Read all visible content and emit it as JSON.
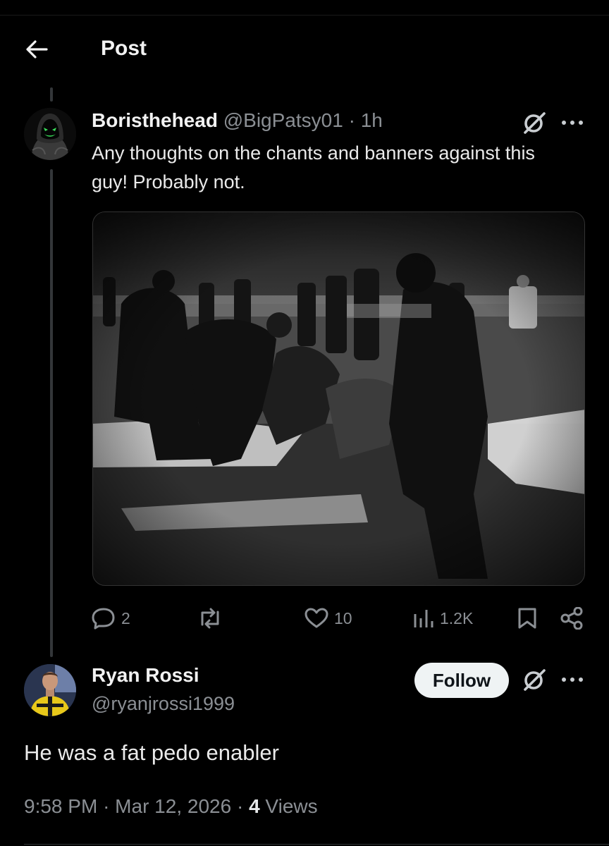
{
  "header": {
    "title": "Post"
  },
  "post": {
    "display_name": "Boristhehead",
    "handle": "@BigPatsy01",
    "separator": "·",
    "time": "1h",
    "text": "Any thoughts on the chants and banners against this guy! Probably not.",
    "stats": {
      "replies": "2",
      "likes": "10",
      "views": "1.2K"
    },
    "icons": [
      "chat-bubble-icon",
      "repost-icon",
      "heart-icon",
      "views-chart-icon",
      "bookmark-icon",
      "share-icon",
      "grok-icon",
      "more-icon"
    ]
  },
  "reply": {
    "display_name": "Ryan Rossi",
    "handle": "@ryanjrossi1999",
    "follow_label": "Follow",
    "text": "He was a fat pedo enabler",
    "time": "9:58 PM",
    "sep1": "·",
    "date": "Mar 12, 2026",
    "sep2": "·",
    "views_count": "4",
    "views_label": "Views"
  },
  "colors": {
    "background": "#000000",
    "text": "#e7e9ea",
    "muted": "#8b8f94",
    "follow_bg": "#eff3f4"
  }
}
